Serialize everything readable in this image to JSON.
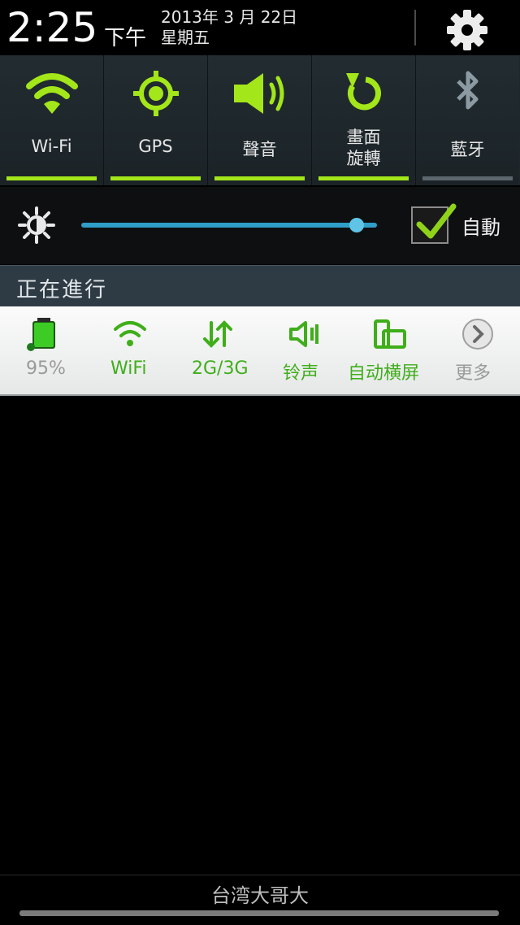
{
  "header": {
    "time": "2:25",
    "ampm": "下午",
    "date": "2013年 3 月 22日",
    "weekday": "星期五",
    "settings_icon": "gear-icon"
  },
  "toggles": [
    {
      "label": "Wi-Fi",
      "icon": "wifi-icon",
      "on": true
    },
    {
      "label": "GPS",
      "icon": "gps-icon",
      "on": true
    },
    {
      "label": "聲音",
      "icon": "speaker-icon",
      "on": true
    },
    {
      "label_line1": "畫面",
      "label_line2": "旋轉",
      "icon": "rotate-icon",
      "on": true
    },
    {
      "label": "藍牙",
      "icon": "bluetooth-icon",
      "on": false
    }
  ],
  "brightness": {
    "level": 0.93,
    "auto_label": "自動",
    "auto_checked": true
  },
  "ongoing": {
    "title": "正在進行"
  },
  "notification": {
    "items": [
      {
        "label": "95%",
        "icon": "battery-icon"
      },
      {
        "label": "WiFi",
        "icon": "wifi-icon"
      },
      {
        "label": "2G/3G",
        "icon": "data-arrows-icon"
      },
      {
        "label": "铃声",
        "icon": "ringer-icon"
      },
      {
        "label": "自动横屏",
        "icon": "auto-rotate-icon"
      },
      {
        "label": "更多",
        "icon": "chevron-right-icon"
      }
    ]
  },
  "carrier": "台湾大哥大",
  "colors": {
    "accent_green": "#a3e619",
    "label_green": "#3fae1a",
    "slider_blue": "#2f9ec8"
  }
}
